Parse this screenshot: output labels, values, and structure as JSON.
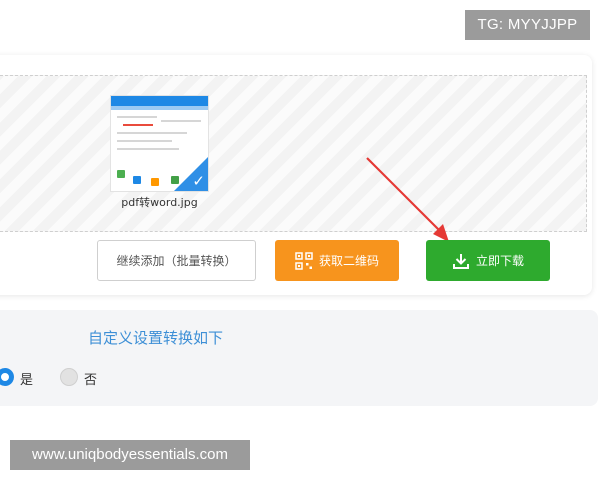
{
  "watermark_top": "TG: MYYJJPP",
  "watermark_bottom": "www.uniqbodyessentials.com",
  "upload": {
    "file_name": "pdf转word.jpg",
    "selected": true
  },
  "buttons": {
    "continue_label": "继续添加（批量转换）",
    "qr_label": "获取二维码",
    "download_label": "立即下载"
  },
  "settings": {
    "title": "自定义设置转换如下",
    "options": [
      {
        "label": "是",
        "checked": true
      },
      {
        "label": "否",
        "checked": false
      }
    ]
  },
  "colors": {
    "qr_button": "#f7941d",
    "download_button": "#2eaa2e",
    "settings_title": "#3d8fd6",
    "arrow": "#e53935"
  },
  "icons": {
    "qr": "qr-code-icon",
    "download": "download-icon",
    "check": "checkmark-icon"
  }
}
